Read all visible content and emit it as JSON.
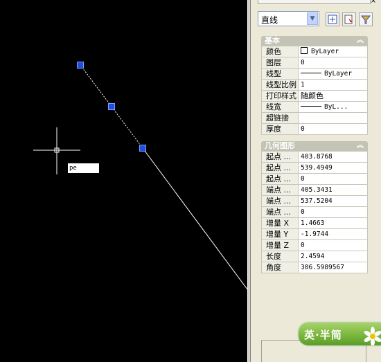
{
  "panel": {
    "close": "×",
    "object_type": "直线",
    "sections": [
      {
        "title": "基本",
        "rows": [
          {
            "name": "颜色",
            "value": "ByLayer",
            "kind": "color"
          },
          {
            "name": "图层",
            "value": "0"
          },
          {
            "name": "线型",
            "value": "ByLayer",
            "kind": "linetype"
          },
          {
            "name": "线型比例",
            "value": "1"
          },
          {
            "name": "打印样式",
            "value": "随颜色"
          },
          {
            "name": "线宽",
            "value": "ByL...",
            "kind": "linetype"
          },
          {
            "name": "超链接",
            "value": ""
          },
          {
            "name": "厚度",
            "value": "0"
          }
        ]
      },
      {
        "title": "几何图形",
        "rows": [
          {
            "name": "起点 ...",
            "value": "403.8768"
          },
          {
            "name": "起点 ...",
            "value": "539.4949"
          },
          {
            "name": "起点 ...",
            "value": "0"
          },
          {
            "name": "端点 ...",
            "value": "405.3431"
          },
          {
            "name": "端点 ...",
            "value": "537.5204"
          },
          {
            "name": "端点 ...",
            "value": "0"
          },
          {
            "name": "增量 X",
            "value": "1.4663"
          },
          {
            "name": "增量 Y",
            "value": "-1.9744"
          },
          {
            "name": "增量 Z",
            "value": "0"
          },
          {
            "name": "长度",
            "value": "2.4594"
          },
          {
            "name": "角度",
            "value": "306.5989567"
          }
        ]
      }
    ]
  },
  "canvas": {
    "command_input": "pe"
  },
  "ime": {
    "label": "英·半简"
  },
  "colors": {
    "canvas_bg": "#000000",
    "grip": "#1f4fe0",
    "section_header": "#c3c3b6",
    "ime": "#76b43a"
  }
}
